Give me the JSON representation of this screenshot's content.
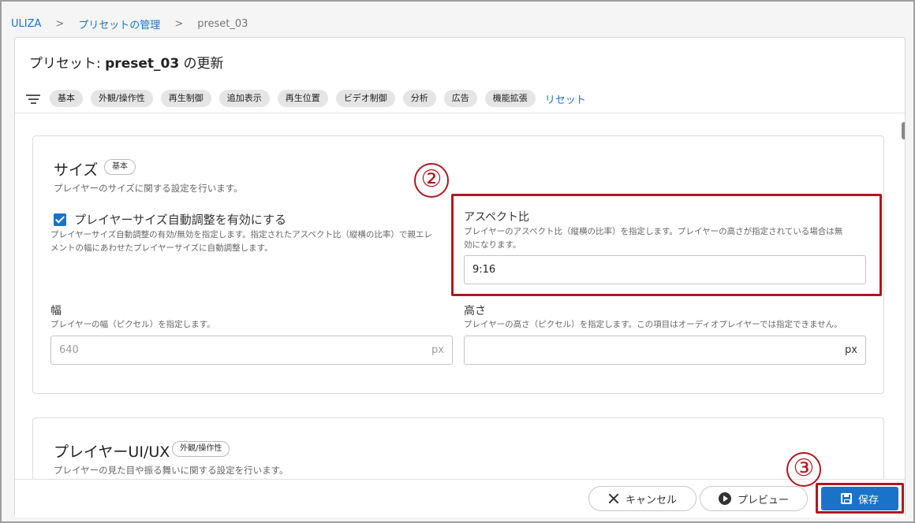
{
  "breadcrumb": {
    "root": "ULIZA",
    "parent": "プリセットの管理",
    "current": "preset_03",
    "separator": ">"
  },
  "header": {
    "title_prefix": "プリセット: ",
    "title_name": "preset_03",
    "title_suffix": " の更新"
  },
  "filters": {
    "icon": "filter-list-icon",
    "chips": [
      "基本",
      "外観/操作性",
      "再生制御",
      "追加表示",
      "再生位置",
      "ビデオ制御",
      "分析",
      "広告",
      "機能拡張"
    ],
    "reset_label": "リセット"
  },
  "size_section": {
    "title": "サイズ",
    "badge": "基本",
    "description": "プレイヤーのサイズに関する設定を行います。",
    "auto_resize": {
      "checked": true,
      "label": "プレイヤーサイズ自動調整を有効にする",
      "description_line1": "プレイヤーサイズ自動調整の有効/無効を指定します。指定されたアスペクト比（縦横の比率）で親エレ",
      "description_line2": "メントの幅にあわせたプレイヤーサイズに自動調整します。"
    },
    "aspect_ratio": {
      "label": "アスペクト比",
      "description_line1": "プレイヤーのアスペクト比（縦横の比率）を指定します。プレイヤーの高さが指定されている場合は無",
      "description_line2": "効になります。",
      "value": "9:16"
    },
    "width": {
      "label": "幅",
      "description": "プレイヤーの幅（ピクセル）を指定します。",
      "value": "640",
      "unit": "px"
    },
    "height": {
      "label": "高さ",
      "description": "プレイヤーの高さ（ピクセル）を指定します。この項目はオーディオプレイヤーでは指定できません。",
      "value": "",
      "unit": "px"
    }
  },
  "uiux_section": {
    "title": "プレイヤーUI/UX",
    "badge": "外観/操作性",
    "description": "プレイヤーの見た目や振る舞いに関する設定を行います。"
  },
  "annotations": {
    "step2": "②",
    "step3": "③",
    "highlight_color": "#b0171f"
  },
  "footer": {
    "cancel_label": "キャンセル",
    "preview_label": "プレビュー",
    "save_label": "保存"
  },
  "colors": {
    "accent": "#1a73c8",
    "chip_bg": "#e5e5e5"
  }
}
